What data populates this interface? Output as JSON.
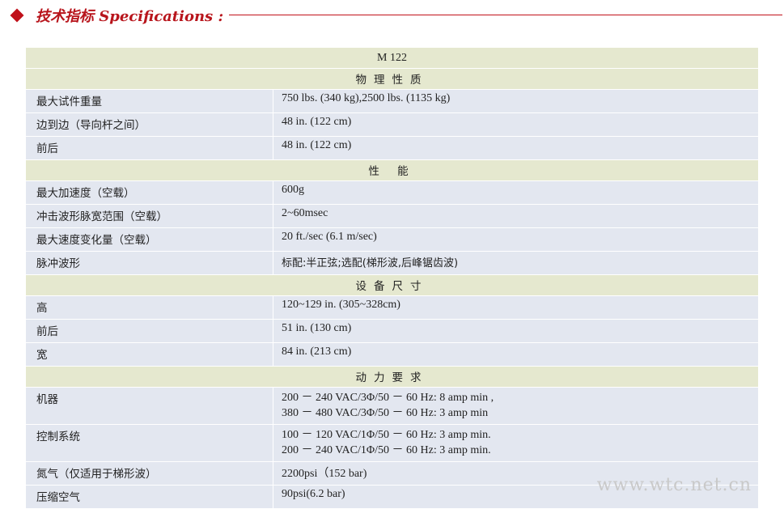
{
  "header": {
    "title": "技术指标 Specifications :"
  },
  "table": {
    "model": "M 122",
    "sections": [
      {
        "title": "物理性质",
        "rows": [
          {
            "label": "最大试件重量",
            "value": "750 lbs. (340 kg),2500 lbs. (1135 kg)"
          },
          {
            "label": "边到边（导向杆之间）",
            "value": "48 in. (122 cm)"
          },
          {
            "label": "前后",
            "value": "48 in. (122 cm)"
          }
        ]
      },
      {
        "title": "性 能",
        "rows": [
          {
            "label": "最大加速度（空载）",
            "value": "600g"
          },
          {
            "label": "冲击波形脉宽范围（空载）",
            "value": "2~60msec"
          },
          {
            "label": "最大速度变化量（空载）",
            "value": "20 ft./sec (6.1 m/sec)"
          },
          {
            "label": "脉冲波形",
            "value": "标配:半正弦;选配(梯形波,后峰锯齿波)"
          }
        ]
      },
      {
        "title": "设备尺寸",
        "rows": [
          {
            "label": "高",
            "value": "120~129 in. (305~328cm)"
          },
          {
            "label": "前后",
            "value": "51 in. (130 cm)"
          },
          {
            "label": "宽",
            "value": "84 in. (213 cm)"
          }
        ]
      },
      {
        "title": "动力要求",
        "rows": [
          {
            "label": "机器",
            "value": "200 － 240 VAC/3Φ/50 － 60 Hz: 8 amp min ,",
            "value2": "380 － 480 VAC/3Φ/50 － 60 Hz: 3 amp min"
          },
          {
            "label": "控制系统",
            "value": "100 － 120 VAC/1Φ/50 － 60 Hz: 3 amp min.",
            "value2": "200 － 240 VAC/1Φ/50 － 60 Hz: 3 amp min."
          },
          {
            "label": "氮气（仅适用于梯形波）",
            "value": "2200psi（152 bar)"
          },
          {
            "label": "压缩空气",
            "value": "90psi(6.2 bar)"
          }
        ]
      }
    ]
  },
  "watermark": "www.wtc.net.cn"
}
